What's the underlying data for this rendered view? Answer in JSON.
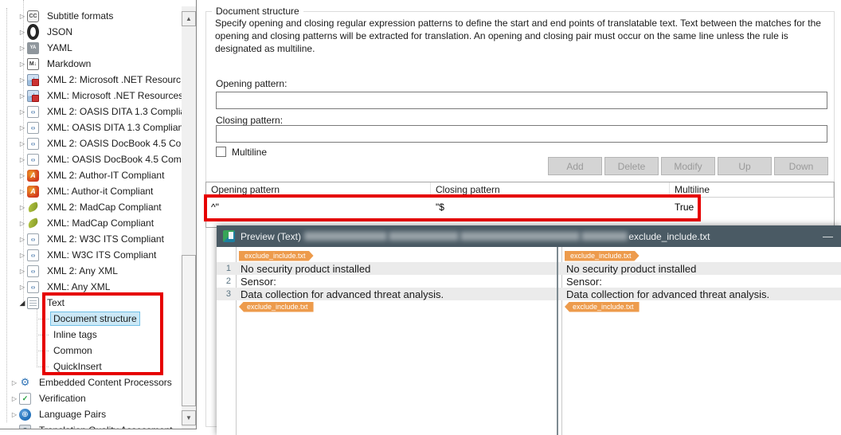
{
  "colors": {
    "annotation_red": "#e60000",
    "tag_orange": "#ed9b4c",
    "preview_titlebar": "#4a5a64",
    "tree_selection_bg": "#cbe8f6",
    "tree_selection_border": "#70c0e7"
  },
  "tree": {
    "items": [
      {
        "label": "Subtitle formats",
        "icon": "subtitles-icon",
        "type": "cc",
        "glyph": "CC",
        "level": 1,
        "state": "collapsed"
      },
      {
        "label": "JSON",
        "icon": "json-icon",
        "type": "json",
        "glyph": "",
        "level": 1,
        "state": "collapsed"
      },
      {
        "label": "YAML",
        "icon": "yaml-icon",
        "type": "yaml",
        "glyph": "YA",
        "level": 1,
        "state": "collapsed"
      },
      {
        "label": "Markdown",
        "icon": "markdown-icon",
        "type": "markdown",
        "glyph": "M↓",
        "level": 1,
        "state": "collapsed"
      },
      {
        "label": "XML 2: Microsoft .NET Resourc",
        "icon": "xml-resource-icon",
        "type": "xmlnet",
        "glyph": "",
        "level": 1,
        "state": "collapsed"
      },
      {
        "label": "XML: Microsoft .NET Resources",
        "icon": "xml-resource-icon",
        "type": "xmlnet",
        "glyph": "",
        "level": 1,
        "state": "collapsed"
      },
      {
        "label": "XML 2: OASIS DITA 1.3 Complia",
        "icon": "xml-file-icon",
        "type": "xmlfile",
        "glyph": "‹›",
        "level": 1,
        "state": "collapsed"
      },
      {
        "label": "XML: OASIS DITA 1.3 Complian",
        "icon": "xml-file-icon",
        "type": "xmlfile",
        "glyph": "‹›",
        "level": 1,
        "state": "collapsed"
      },
      {
        "label": "XML 2: OASIS DocBook 4.5 Co",
        "icon": "xml-file-icon",
        "type": "xmlfile",
        "glyph": "‹›",
        "level": 1,
        "state": "collapsed"
      },
      {
        "label": "XML: OASIS DocBook 4.5 Com",
        "icon": "xml-file-icon",
        "type": "xmlfile",
        "glyph": "‹›",
        "level": 1,
        "state": "collapsed"
      },
      {
        "label": "XML 2: Author-IT Compliant",
        "icon": "author-it-icon",
        "type": "author",
        "glyph": "A",
        "level": 1,
        "state": "collapsed"
      },
      {
        "label": "XML: Author-it Compliant",
        "icon": "author-it-icon",
        "type": "author",
        "glyph": "A",
        "level": 1,
        "state": "collapsed"
      },
      {
        "label": "XML 2: MadCap Compliant",
        "icon": "madcap-icon",
        "type": "madcap",
        "glyph": "",
        "level": 1,
        "state": "collapsed"
      },
      {
        "label": "XML: MadCap Compliant",
        "icon": "madcap-icon",
        "type": "madcap",
        "glyph": "",
        "level": 1,
        "state": "collapsed"
      },
      {
        "label": "XML 2: W3C ITS Compliant",
        "icon": "xml-file-icon",
        "type": "xmlfile",
        "glyph": "‹›",
        "level": 1,
        "state": "collapsed"
      },
      {
        "label": "XML: W3C ITS Compliant",
        "icon": "xml-file-icon",
        "type": "xmlfile",
        "glyph": "‹›",
        "level": 1,
        "state": "collapsed"
      },
      {
        "label": "XML 2: Any XML",
        "icon": "xml-file-icon",
        "type": "xmlfile",
        "glyph": "‹›",
        "level": 1,
        "state": "collapsed"
      },
      {
        "label": "XML: Any XML",
        "icon": "xml-file-icon",
        "type": "xmlfile",
        "glyph": "‹›",
        "level": 1,
        "state": "collapsed"
      },
      {
        "label": "Text",
        "icon": "text-file-icon",
        "type": "textfile",
        "glyph": "",
        "level": 1,
        "state": "expanded"
      },
      {
        "label": "Document structure",
        "icon": "",
        "type": "",
        "glyph": "",
        "level": 2,
        "state": "child",
        "selected": true
      },
      {
        "label": "Inline tags",
        "icon": "",
        "type": "",
        "glyph": "",
        "level": 2,
        "state": "child"
      },
      {
        "label": "Common",
        "icon": "",
        "type": "",
        "glyph": "",
        "level": 2,
        "state": "child"
      },
      {
        "label": "QuickInsert",
        "icon": "",
        "type": "",
        "glyph": "",
        "level": 2,
        "state": "child"
      },
      {
        "label": "Embedded Content Processors",
        "icon": "gear-icon",
        "type": "gear",
        "glyph": "⚙",
        "level": 0,
        "state": "collapsed"
      },
      {
        "label": "Verification",
        "icon": "verification-check-icon",
        "type": "verify",
        "glyph": "✓",
        "level": 0,
        "state": "collapsed"
      },
      {
        "label": "Language Pairs",
        "icon": "globe-icon",
        "type": "globe",
        "glyph": "⊕",
        "level": 0,
        "state": "collapsed"
      },
      {
        "label": "Translation Quality Assessment",
        "icon": "tqa-icon",
        "type": "doc",
        "glyph": "Q",
        "level": 0,
        "state": "collapsed"
      }
    ]
  },
  "panel": {
    "group_title": "Document structure",
    "description": "Specify opening and closing regular expression patterns to define the start and end points of translatable text. Text between the matches for the opening and closing patterns will be extracted for translation. An opening and closing pair must occur on the same line unless the rule is designated as multiline.",
    "opening_label": "Opening pattern:",
    "opening_value": "",
    "closing_label": "Closing pattern:",
    "closing_value": "",
    "multiline_label": "Multiline",
    "multiline_checked": false,
    "buttons": [
      "Add",
      "Delete",
      "Modify",
      "Up",
      "Down"
    ],
    "table": {
      "headers": [
        "Opening pattern",
        "Closing pattern",
        "Multiline"
      ],
      "rows": [
        [
          "^\"",
          "\"$",
          "True"
        ]
      ]
    }
  },
  "preview": {
    "title": "Preview (Text)",
    "filename": "exclude_include.txt",
    "minimize_glyph": "—",
    "tag_label": "exclude_include.txt",
    "lines": [
      {
        "num": "1",
        "text": "No security product installed"
      },
      {
        "num": "2",
        "text": "Sensor:"
      },
      {
        "num": "3",
        "text": "Data collection for advanced threat analysis."
      }
    ]
  }
}
